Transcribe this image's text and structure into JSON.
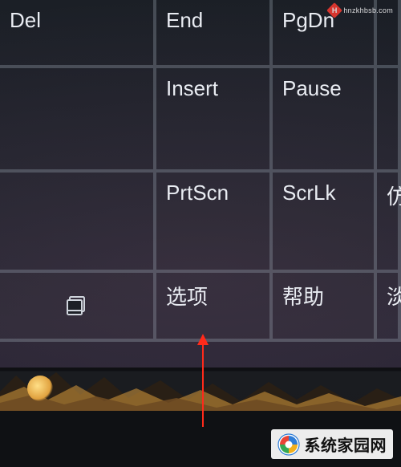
{
  "keyboard": {
    "rows": [
      {
        "keys": [
          {
            "id": "key-del",
            "label": "Del"
          },
          {
            "id": "key-end",
            "label": "End"
          },
          {
            "id": "key-pgdn",
            "label": "PgDn"
          },
          {
            "id": "sliver-r0",
            "label": ""
          }
        ]
      },
      {
        "keys": [
          {
            "id": "key-blank1",
            "label": ""
          },
          {
            "id": "key-insert",
            "label": "Insert"
          },
          {
            "id": "key-pause",
            "label": "Pause"
          },
          {
            "id": "sliver-r1",
            "label": ""
          }
        ]
      },
      {
        "keys": [
          {
            "id": "key-blank2",
            "label": ""
          },
          {
            "id": "key-prtscn",
            "label": "PrtScn"
          },
          {
            "id": "key-scrlk",
            "label": "ScrLk"
          },
          {
            "id": "sliver-r2",
            "label": "仿"
          }
        ]
      },
      {
        "keys": [
          {
            "id": "key-dock",
            "label": "",
            "icon": "dock-icon"
          },
          {
            "id": "key-options",
            "label": "选项"
          },
          {
            "id": "key-help",
            "label": "帮助"
          },
          {
            "id": "sliver-r3",
            "label": "淡"
          }
        ]
      }
    ]
  },
  "annotation": {
    "arrow_target": "key-options",
    "arrow_color": "#ff2a1a"
  },
  "watermark_top": {
    "badge_letter": "H",
    "text": "hnzkhbsb.com"
  },
  "watermark_bottom": {
    "text": "系统家园网",
    "sub": ""
  }
}
